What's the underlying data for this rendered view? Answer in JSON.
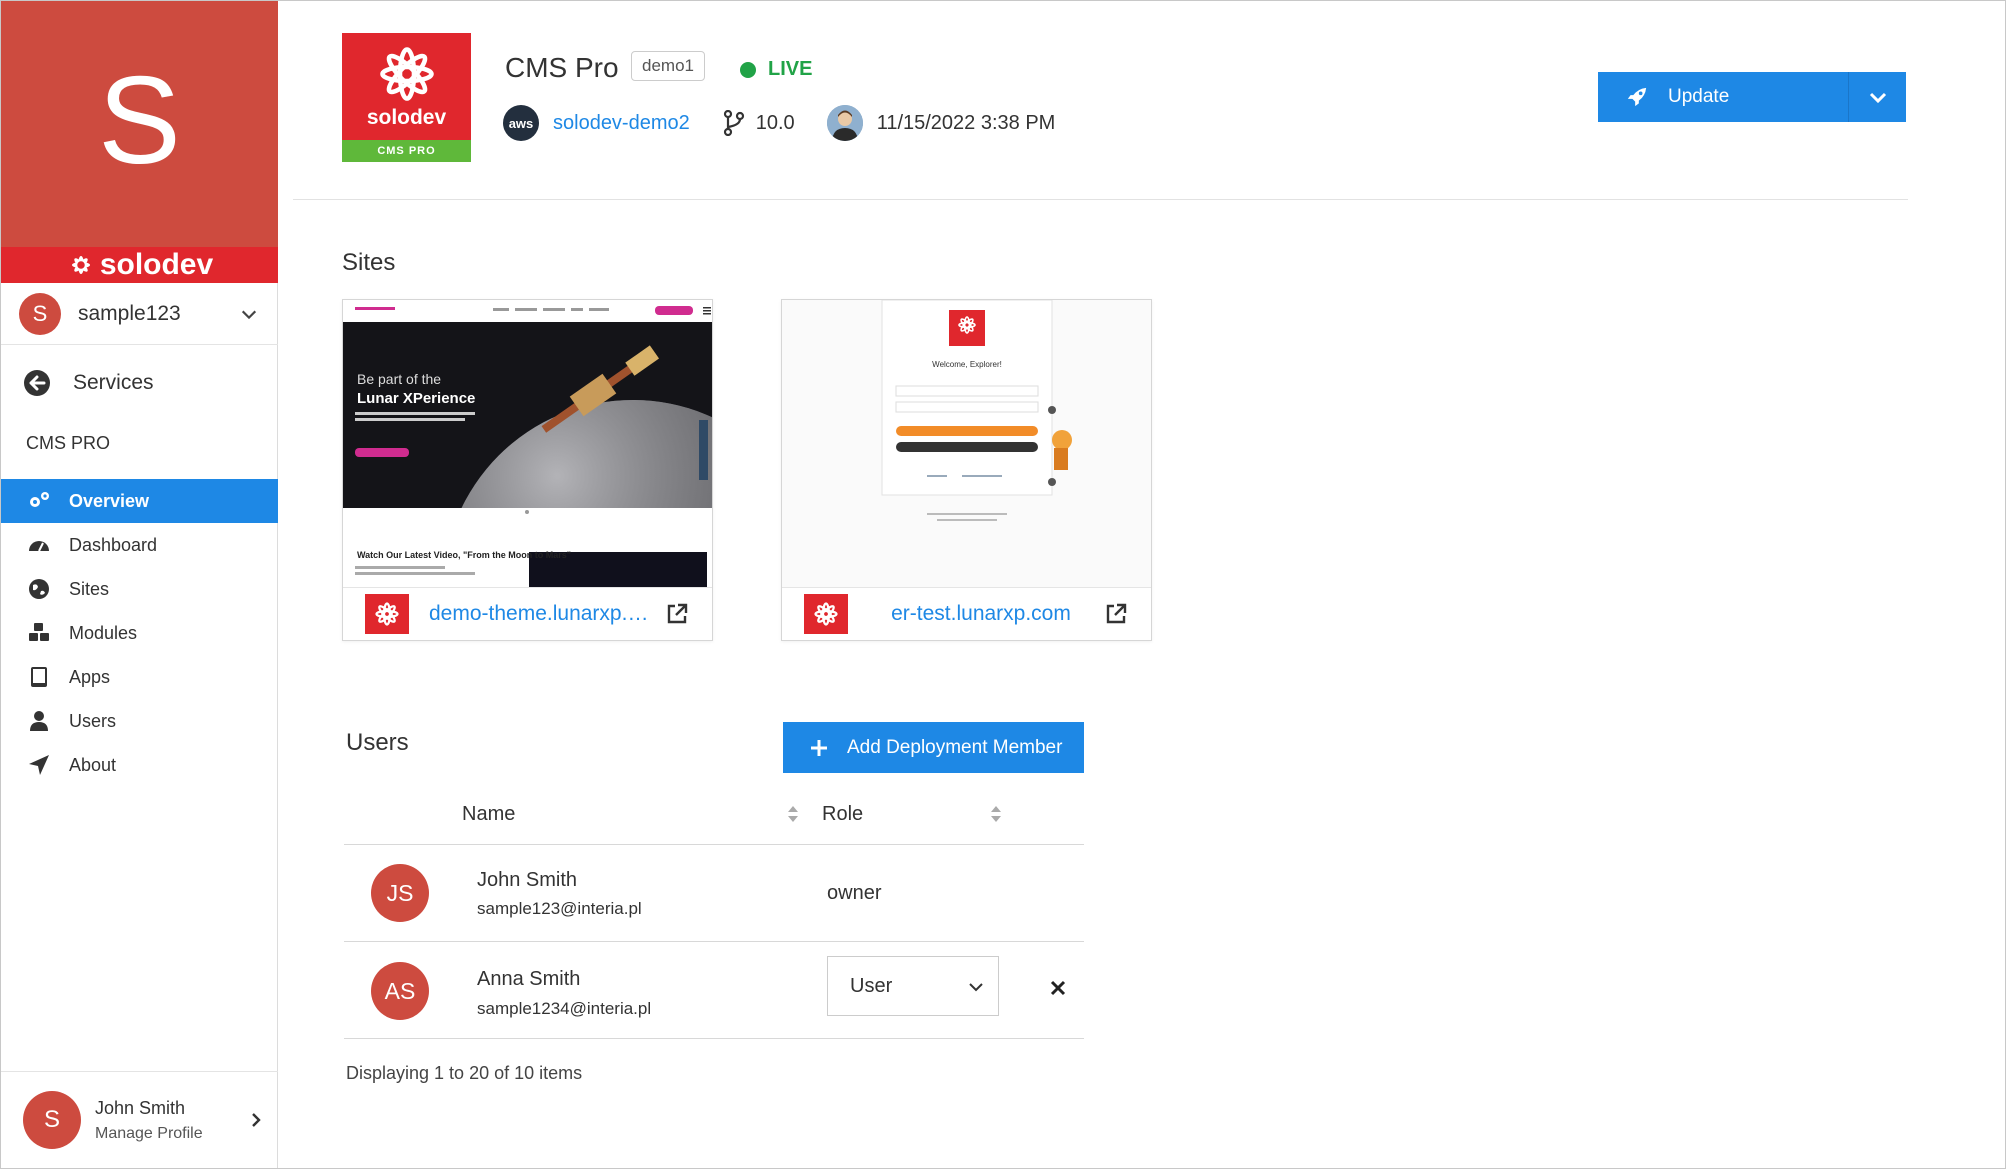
{
  "brand": {
    "letter": "S",
    "name": "solodev",
    "colors": {
      "brand_red": "#cd4b3f",
      "strip_red": "#e0272d",
      "accent_blue": "#1e88e5",
      "live_green": "#21a347"
    }
  },
  "account": {
    "initial": "S",
    "name": "sample123"
  },
  "back_nav": {
    "label": "Services"
  },
  "section": {
    "label": "CMS PRO"
  },
  "nav": {
    "items": [
      {
        "label": "Overview",
        "icon": "gears-icon",
        "active": true
      },
      {
        "label": "Dashboard",
        "icon": "dashboard-icon",
        "active": false
      },
      {
        "label": "Sites",
        "icon": "globe-icon",
        "active": false
      },
      {
        "label": "Modules",
        "icon": "modules-icon",
        "active": false
      },
      {
        "label": "Apps",
        "icon": "tablet-icon",
        "active": false
      },
      {
        "label": "Users",
        "icon": "user-icon",
        "active": false
      },
      {
        "label": "About",
        "icon": "paper-plane-icon",
        "active": false
      }
    ]
  },
  "profile": {
    "initial": "S",
    "name": "John Smith",
    "sub": "Manage Profile"
  },
  "header": {
    "logo_word": "solodev",
    "logo_band": "CMS PRO",
    "title": "CMS Pro",
    "env": "demo1",
    "status": "LIVE",
    "aws_label": "aws",
    "stack_link": "solodev-demo2",
    "version": "10.0",
    "date": "11/15/2022 3:38 PM",
    "update_label": "Update"
  },
  "sites": {
    "title": "Sites",
    "cards": [
      {
        "link": "demo-theme.lunarxp.com",
        "thumb_headline_1": "Be part of the",
        "thumb_headline_2": "Lunar XPerience",
        "thumb_sub": "Watch Our Latest Video, \"From the Moon to Mars\""
      },
      {
        "link": "er-test.lunarxp.com",
        "thumb_headline_1": "Welcome, Explorer!"
      }
    ]
  },
  "users": {
    "title": "Users",
    "add_label": "Add Deployment Member",
    "columns": {
      "name": "Name",
      "role": "Role"
    },
    "rows": [
      {
        "initials": "JS",
        "name": "John Smith",
        "email": "sample123@interia.pl",
        "role": "owner",
        "editable": false
      },
      {
        "initials": "AS",
        "name": "Anna Smith",
        "email": "sample1234@interia.pl",
        "role": "User",
        "editable": true
      }
    ],
    "pager": "Displaying 1 to 20 of 10 items"
  }
}
